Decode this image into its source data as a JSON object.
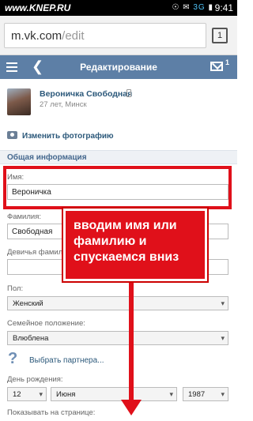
{
  "status_bar": {
    "brand": "www.KNEP.RU",
    "network": "3G",
    "time": "9:41"
  },
  "browser": {
    "url_host": "m.vk.com",
    "url_path": "/edit",
    "tab_count": "1"
  },
  "vk_header": {
    "title": "Редактирование",
    "mail_badge": "1"
  },
  "profile": {
    "name": "Вероничка Свободная",
    "meta": "27 лет, Минск"
  },
  "change_photo_label": "Изменить фотографию",
  "section_title": "Общая информация",
  "form": {
    "first_name_label": "Имя:",
    "first_name_value": "Вероничка",
    "last_name_label": "Фамилия:",
    "last_name_value": "Свободная",
    "maiden_name_label": "Девичья фамилия:",
    "gender_label": "Пол:",
    "gender_value": "Женский",
    "relationship_label": "Семейное положение:",
    "relationship_value": "Влюблена",
    "choose_partner": "Выбрать партнера...",
    "birthday_label": "День рождения:",
    "birthday_day": "12",
    "birthday_month": "Июня",
    "birthday_year": "1987",
    "show_on_page_label": "Показывать на странице:"
  },
  "annotation": {
    "callout_text": "вводим имя или фамилию и спускаемся вниз",
    "color": "#e0101a"
  }
}
